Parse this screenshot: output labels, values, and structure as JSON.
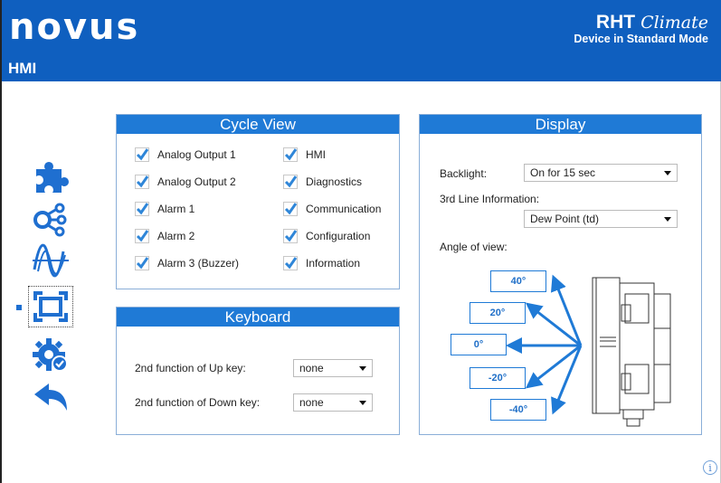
{
  "header": {
    "logo": "NOVUS",
    "page": "HMI",
    "product_name": "RHT",
    "product_script": "Climate",
    "mode": "Device in Standard Mode"
  },
  "nav": {
    "items": [
      "puzzle-icon",
      "network-icon",
      "wave-icon",
      "frame-icon",
      "gear-check-icon",
      "back-arrow-icon"
    ],
    "active": "frame-icon"
  },
  "cycle_view": {
    "title": "Cycle View",
    "left": [
      "Analog Output 1",
      "Analog Output 2",
      "Alarm 1",
      "Alarm 2",
      "Alarm 3 (Buzzer)"
    ],
    "right": [
      "HMI",
      "Diagnostics",
      "Communication",
      "Configuration",
      "Information"
    ],
    "checked": true
  },
  "keyboard": {
    "title": "Keyboard",
    "up_label": "2nd function of Up key:",
    "up_value": "none",
    "down_label": "2nd function of Down key:",
    "down_value": "none"
  },
  "display": {
    "title": "Display",
    "backlight_label": "Backlight:",
    "backlight_value": "On for 15 sec",
    "line3_label": "3rd Line Information:",
    "line3_value": "Dew Point (td)",
    "angle_label": "Angle of view:",
    "angles": [
      "40°",
      "20°",
      "0°",
      "-20°",
      "-40°"
    ]
  },
  "footer": {
    "info": "i"
  },
  "colors": {
    "header": "#0f5fbf",
    "panel_title": "#1f7ad6",
    "check": "#2f86d8"
  }
}
